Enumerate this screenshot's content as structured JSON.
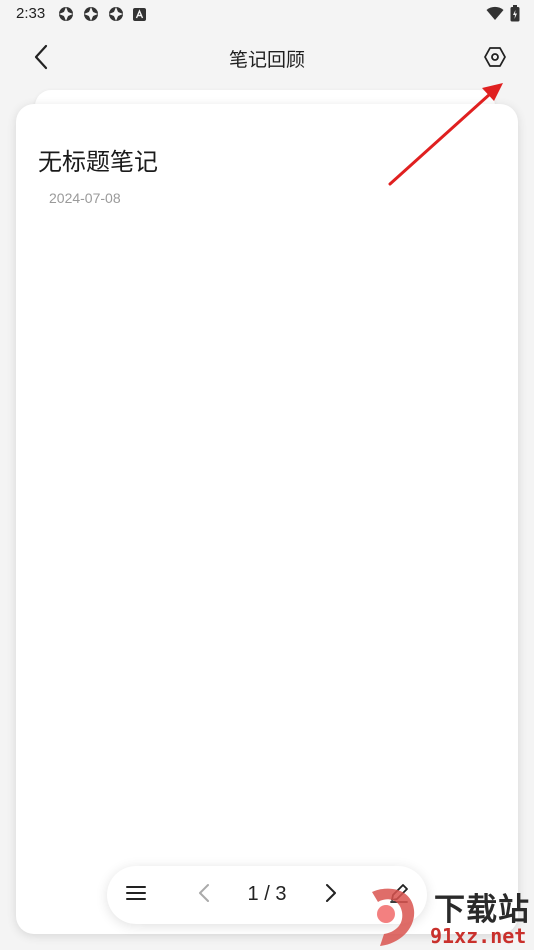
{
  "status_bar": {
    "time": "2:33",
    "left_icons": [
      "app-notification-icon",
      "app-notification-icon",
      "app-notification-icon",
      "a-badge-icon"
    ],
    "right_icons": [
      "wifi-icon",
      "battery-icon"
    ]
  },
  "header": {
    "title": "笔记回顾",
    "back_icon": "chevron-left-icon",
    "settings_icon": "hexagon-settings-icon"
  },
  "note": {
    "title": "无标题笔记",
    "date": "2024-07-08"
  },
  "bottom_bar": {
    "menu_icon": "menu-icon",
    "prev_icon": "chevron-left-icon",
    "page_indicator": "1 / 3",
    "next_icon": "chevron-right-icon",
    "edit_icon": "pencil-icon"
  },
  "annotation": {
    "arrow_color": "#e02020"
  },
  "watermark": {
    "main_text": "下载站",
    "sub_text": "91xz.net"
  },
  "colors": {
    "background": "#f4f4f4",
    "card": "#ffffff",
    "text_primary": "#1a1a1a",
    "text_secondary": "#9a9a9a"
  }
}
